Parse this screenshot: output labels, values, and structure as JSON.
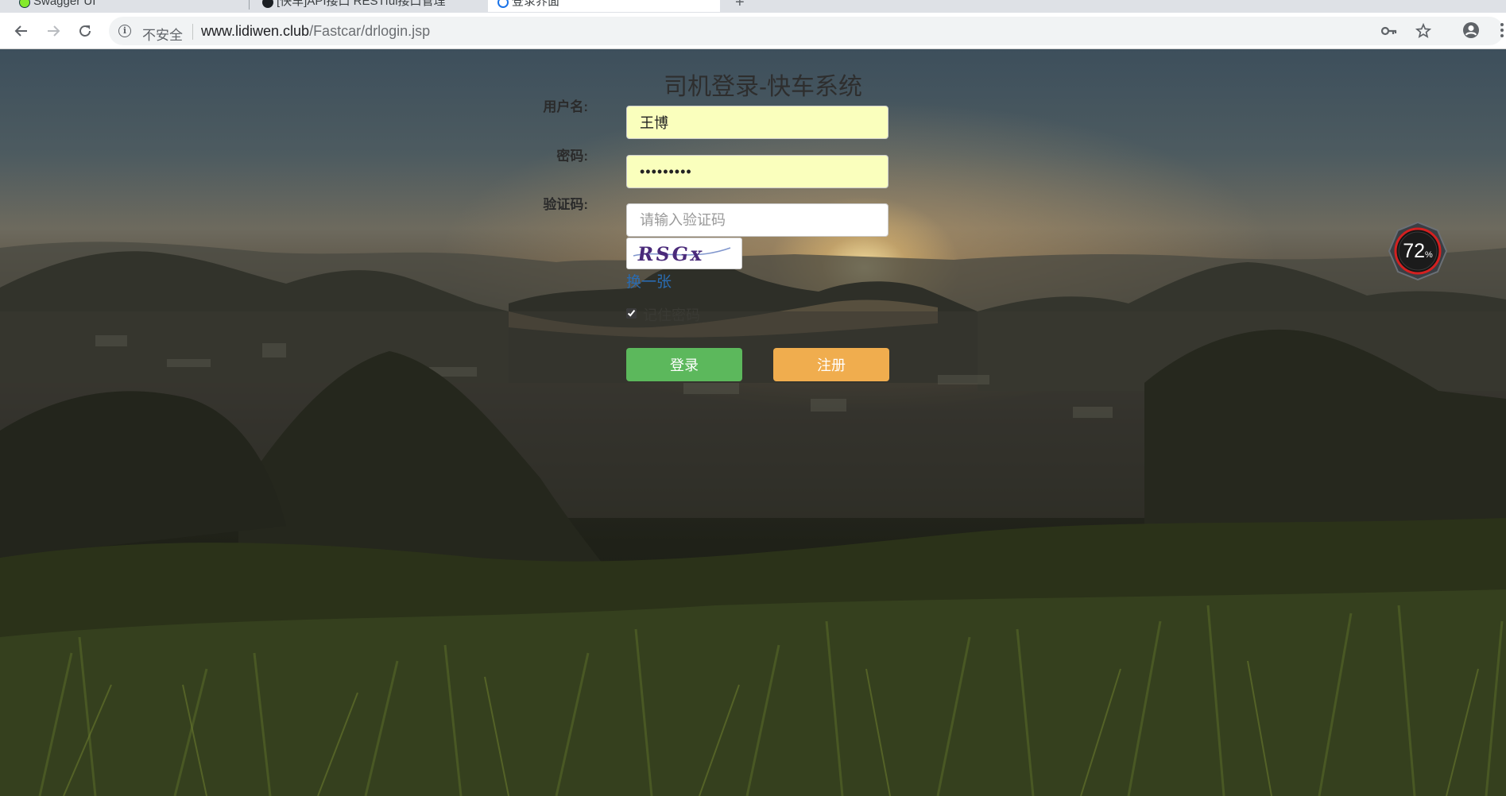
{
  "browser": {
    "tabs": [
      {
        "label": "Swagger UI",
        "active": false,
        "icon": "swagger-icon"
      },
      {
        "label": "[快车]API接口 RESTful接口管理",
        "active": false,
        "icon": "github-icon"
      },
      {
        "label": "登录界面",
        "active": true,
        "icon": "loading-icon"
      }
    ],
    "new_tab_label": "+",
    "security_label": "不安全",
    "url_host": "www.lidiwen.club",
    "url_path": "/Fastcar/drlogin.jsp"
  },
  "login": {
    "title": "司机登录-快车系统",
    "username_label": "用户名:",
    "username_value": "王博",
    "password_label": "密码:",
    "password_value": "123456789",
    "captcha_label": "验证码:",
    "captcha_placeholder": "请输入验证码",
    "captcha_image_text": "RSGx",
    "refresh_link": "换一张",
    "remember_label": "记住密码",
    "remember_checked": true,
    "login_button": "登录",
    "register_button": "注册"
  },
  "widget": {
    "percent_value": "72",
    "percent_sign": "%"
  },
  "colors": {
    "login_button": "#5cb85c",
    "register_button": "#f0ad4e",
    "autofill_background": "#faffbd",
    "link": "#2a6bb0"
  }
}
